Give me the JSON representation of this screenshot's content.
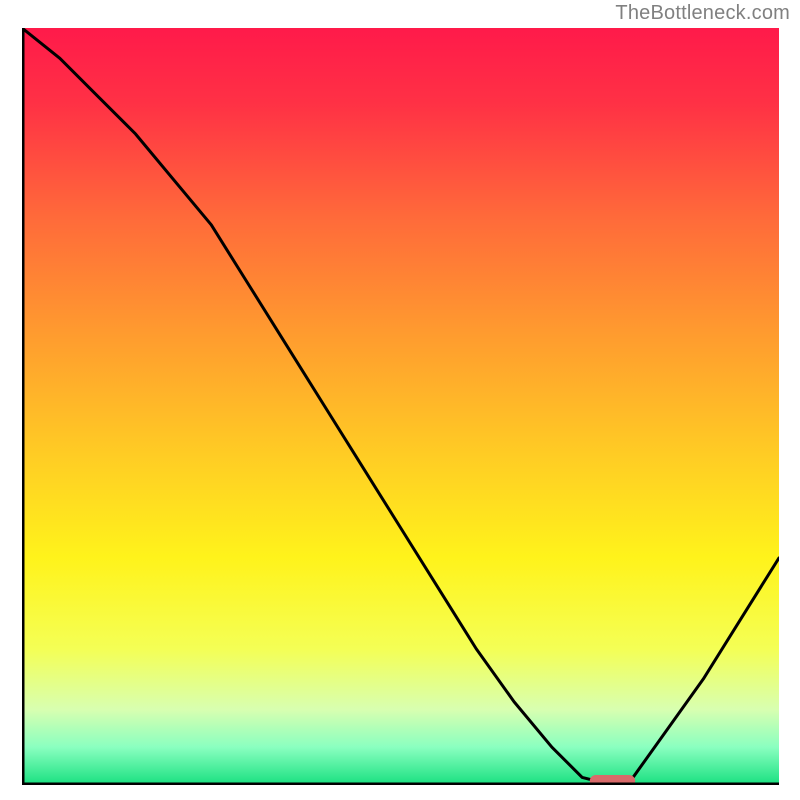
{
  "watermark": "TheBottleneck.com",
  "chart_data": {
    "type": "line",
    "xlim": [
      0,
      100
    ],
    "ylim": [
      0,
      100
    ],
    "title": "",
    "xlabel": "",
    "ylabel": "",
    "x": [
      0,
      5,
      10,
      15,
      20,
      25,
      30,
      35,
      40,
      45,
      50,
      55,
      60,
      65,
      70,
      74,
      78,
      80,
      85,
      90,
      95,
      100
    ],
    "values": [
      100,
      96,
      91,
      86,
      80,
      74,
      66,
      58,
      50,
      42,
      34,
      26,
      18,
      11,
      5,
      1,
      0,
      0,
      7,
      14,
      22,
      30
    ],
    "marker": {
      "x": 78,
      "y": 0,
      "width": 6
    },
    "gradient_stops": [
      {
        "offset": 0.0,
        "color": "#ff1a4a"
      },
      {
        "offset": 0.1,
        "color": "#ff3145"
      },
      {
        "offset": 0.25,
        "color": "#ff6a3a"
      },
      {
        "offset": 0.4,
        "color": "#ff9a2f"
      },
      {
        "offset": 0.55,
        "color": "#ffc825"
      },
      {
        "offset": 0.7,
        "color": "#fff31b"
      },
      {
        "offset": 0.82,
        "color": "#f4ff55"
      },
      {
        "offset": 0.9,
        "color": "#d8ffb0"
      },
      {
        "offset": 0.95,
        "color": "#8affc0"
      },
      {
        "offset": 1.0,
        "color": "#18e080"
      }
    ]
  }
}
